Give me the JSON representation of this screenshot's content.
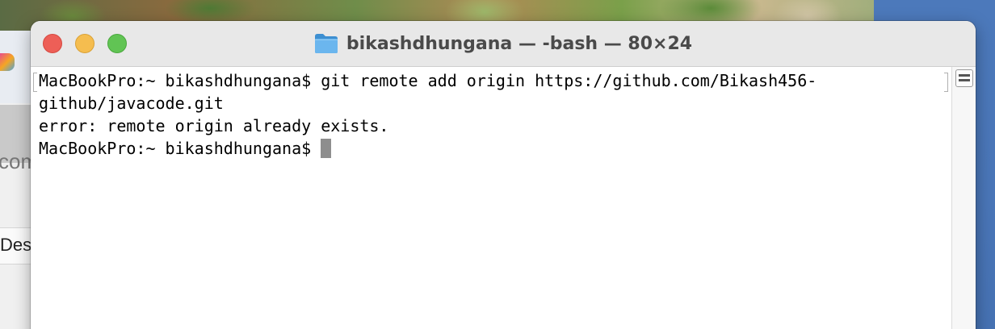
{
  "window": {
    "title": "bikashdhungana — -bash — 80×24"
  },
  "background": {
    "partial_text_1": "com",
    "partial_text_2": "Des"
  },
  "terminal": {
    "lines": [
      "MacBookPro:~ bikashdhungana$ git remote add origin https://github.com/Bikash456-",
      "github/javacode.git",
      "error: remote origin already exists.",
      "MacBookPro:~ bikashdhungana$ "
    ],
    "cursor_color": "#8e8e8e"
  },
  "icons": {
    "title_icon": "folder-icon",
    "split_icon": "split-pane-icon"
  },
  "colors": {
    "close": "#ed5f57",
    "minimize": "#f5bd4f",
    "maximize": "#61c454",
    "folder": "#4fa3e0"
  }
}
